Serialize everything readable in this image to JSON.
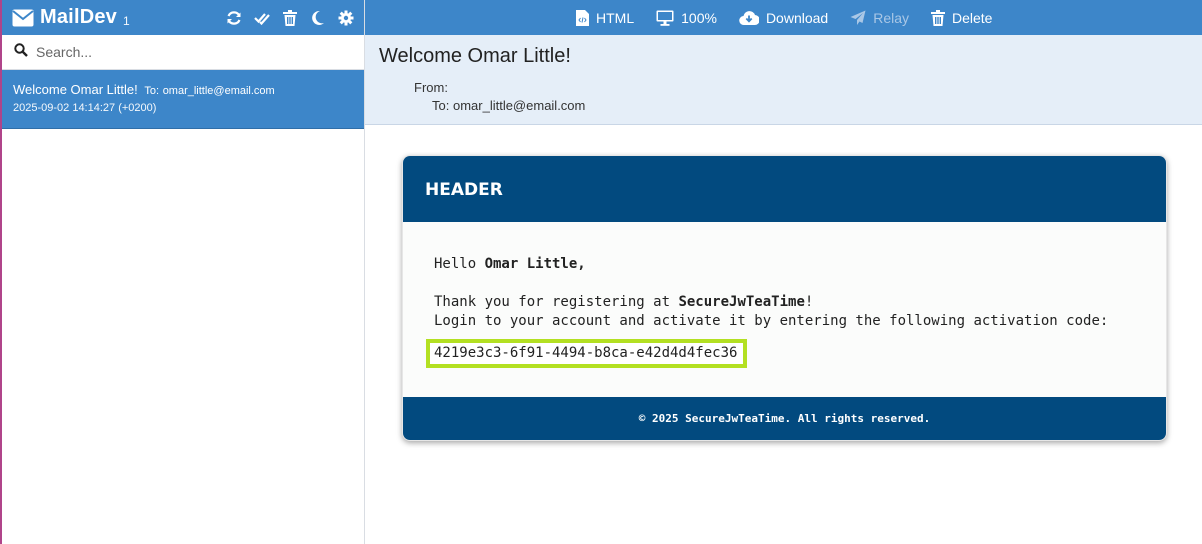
{
  "app": {
    "name": "MailDev",
    "count": "1"
  },
  "sidebar_tools": [
    "refresh-icon",
    "mark-all-read-icon",
    "trash-icon",
    "moon-icon",
    "gear-icon"
  ],
  "search": {
    "placeholder": "Search..."
  },
  "emails": [
    {
      "subject": "Welcome Omar Little!",
      "to_label": "To:",
      "to": "omar_little@email.com",
      "date": "2025-09-02 14:14:27 (+0200)"
    }
  ],
  "toolbar": {
    "html_label": "HTML",
    "zoom_label": "100%",
    "download_label": "Download",
    "relay_label": "Relay",
    "delete_label": "Delete"
  },
  "message": {
    "subject": "Welcome Omar Little!",
    "from_label": "From:",
    "from_value": "",
    "to_label": "To:",
    "to_value": "omar_little@email.com"
  },
  "email_content": {
    "header": "HEADER",
    "greeting_prefix": "Hello ",
    "recipient_name": "Omar Little,",
    "thanks_prefix": "Thank you for registering at ",
    "service_name": "SecureJwTeaTime",
    "thanks_suffix": "!",
    "instruction": "Login to your account and activate it by entering the following activation code:",
    "activation_code": "4219e3c3-6f91-4494-b8ca-e42d4d4fec36",
    "footer": "© 2025 SecureJwTeaTime. All rights reserved."
  },
  "colors": {
    "topbar": "#3d86c9",
    "email_brand": "#024a7f",
    "highlight_border": "#b3e022"
  }
}
